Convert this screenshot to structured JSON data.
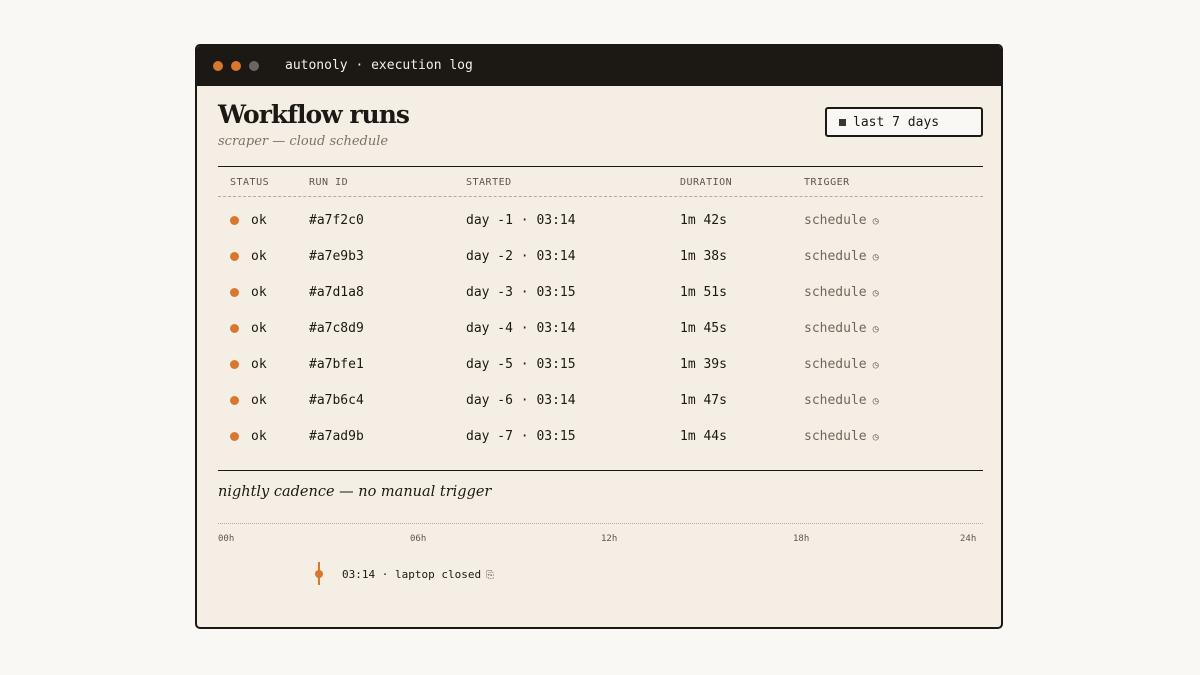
{
  "window": {
    "title": "autonoly · execution log"
  },
  "page": {
    "title": "Workflow runs",
    "subtitle": "scraper — cloud schedule"
  },
  "range_filter": {
    "label": "last 7 days"
  },
  "table": {
    "headers": [
      "STATUS",
      "RUN ID",
      "STARTED",
      "DURATION",
      "TRIGGER"
    ],
    "rows": [
      {
        "status": "ok",
        "run_id": "#a7f2c0",
        "started": "day -1 · 03:14",
        "duration": "1m 42s",
        "trigger": "schedule"
      },
      {
        "status": "ok",
        "run_id": "#a7e9b3",
        "started": "day -2 · 03:14",
        "duration": "1m 38s",
        "trigger": "schedule"
      },
      {
        "status": "ok",
        "run_id": "#a7d1a8",
        "started": "day -3 · 03:15",
        "duration": "1m 51s",
        "trigger": "schedule"
      },
      {
        "status": "ok",
        "run_id": "#a7c8d9",
        "started": "day -4 · 03:14",
        "duration": "1m 45s",
        "trigger": "schedule"
      },
      {
        "status": "ok",
        "run_id": "#a7bfe1",
        "started": "day -5 · 03:15",
        "duration": "1m 39s",
        "trigger": "schedule"
      },
      {
        "status": "ok",
        "run_id": "#a7b6c4",
        "started": "day -6 · 03:14",
        "duration": "1m 47s",
        "trigger": "schedule"
      },
      {
        "status": "ok",
        "run_id": "#a7ad9b",
        "started": "day -7 · 03:15",
        "duration": "1m 44s",
        "trigger": "schedule"
      }
    ]
  },
  "cadence": {
    "caption": "nightly cadence — no manual trigger",
    "ticks": [
      "00h",
      "06h",
      "12h",
      "18h",
      "24h"
    ],
    "event": {
      "time_hours": 3.23,
      "label": "03:14 · laptop closed"
    }
  },
  "icons": {
    "trigger": "clock-icon",
    "event": "laptop-icon",
    "status_ok": "status-dot-icon",
    "range": "square-icon"
  },
  "colors": {
    "accent": "#d9772e",
    "ink": "#1c1813",
    "paper": "#f4eee4"
  }
}
